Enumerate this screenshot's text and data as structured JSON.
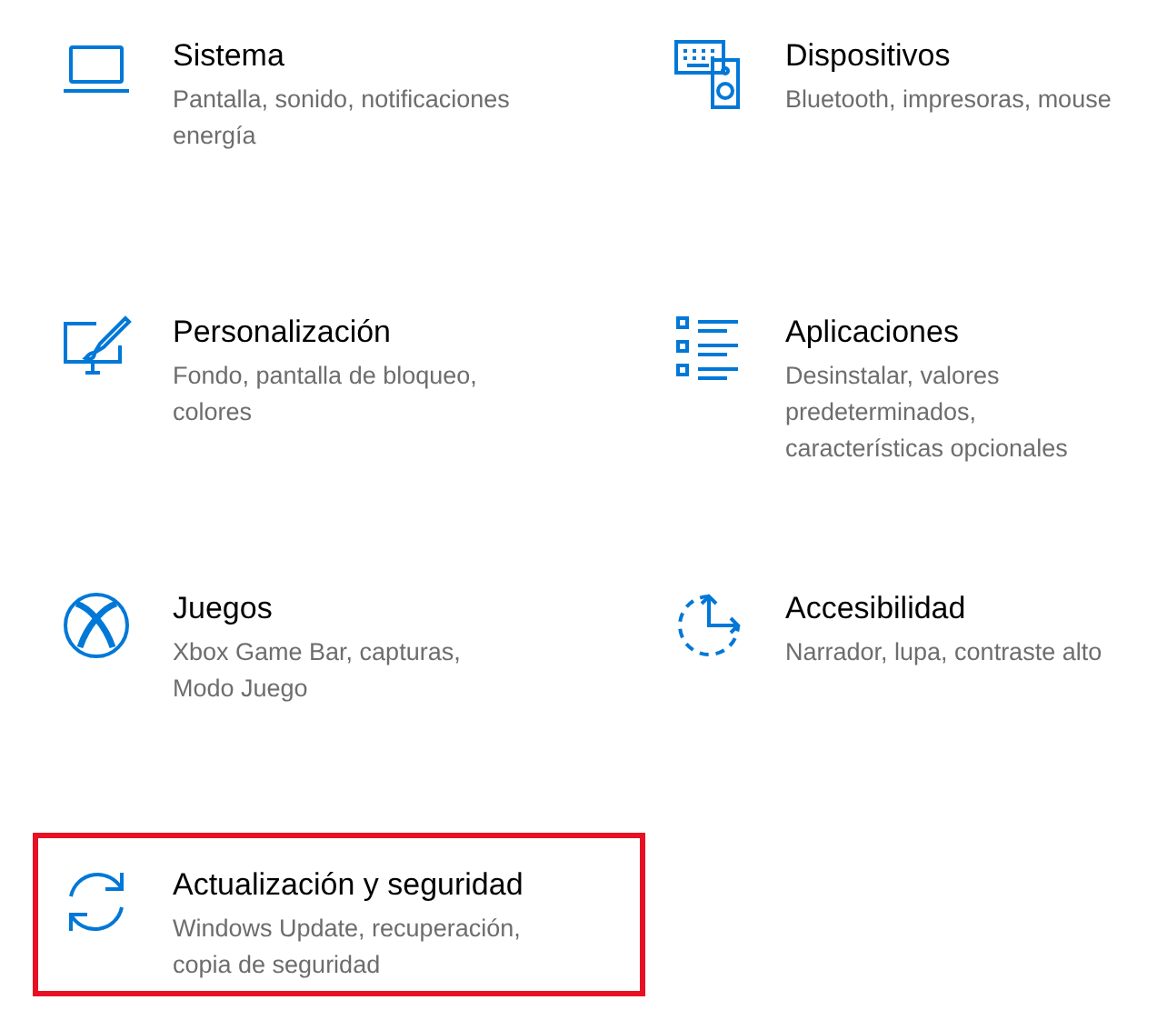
{
  "categories": [
    {
      "title": "Sistema",
      "description_lines": [
        "Pantalla, sonido, notificaciones",
        "energía"
      ],
      "highlighted": false
    },
    {
      "title": "Dispositivos",
      "description_lines": [
        "Bluetooth, impresoras, mouse"
      ],
      "highlighted": false
    },
    {
      "title": "Personalización",
      "description_lines": [
        "Fondo, pantalla de bloqueo,",
        "colores"
      ],
      "highlighted": false
    },
    {
      "title": "Aplicaciones",
      "description_lines": [
        "Desinstalar, valores",
        "predeterminados,",
        "características opcionales"
      ],
      "highlighted": false
    },
    {
      "title": "Juegos",
      "description_lines": [
        "Xbox Game Bar, capturas,",
        "Modo Juego"
      ],
      "highlighted": false
    },
    {
      "title": "Accesibilidad",
      "description_lines": [
        "Narrador, lupa, contraste alto"
      ],
      "highlighted": false
    },
    {
      "title": "Actualización y seguridad",
      "description_lines": [
        "Windows Update, recuperación,",
        "copia de seguridad"
      ],
      "highlighted": true
    }
  ]
}
